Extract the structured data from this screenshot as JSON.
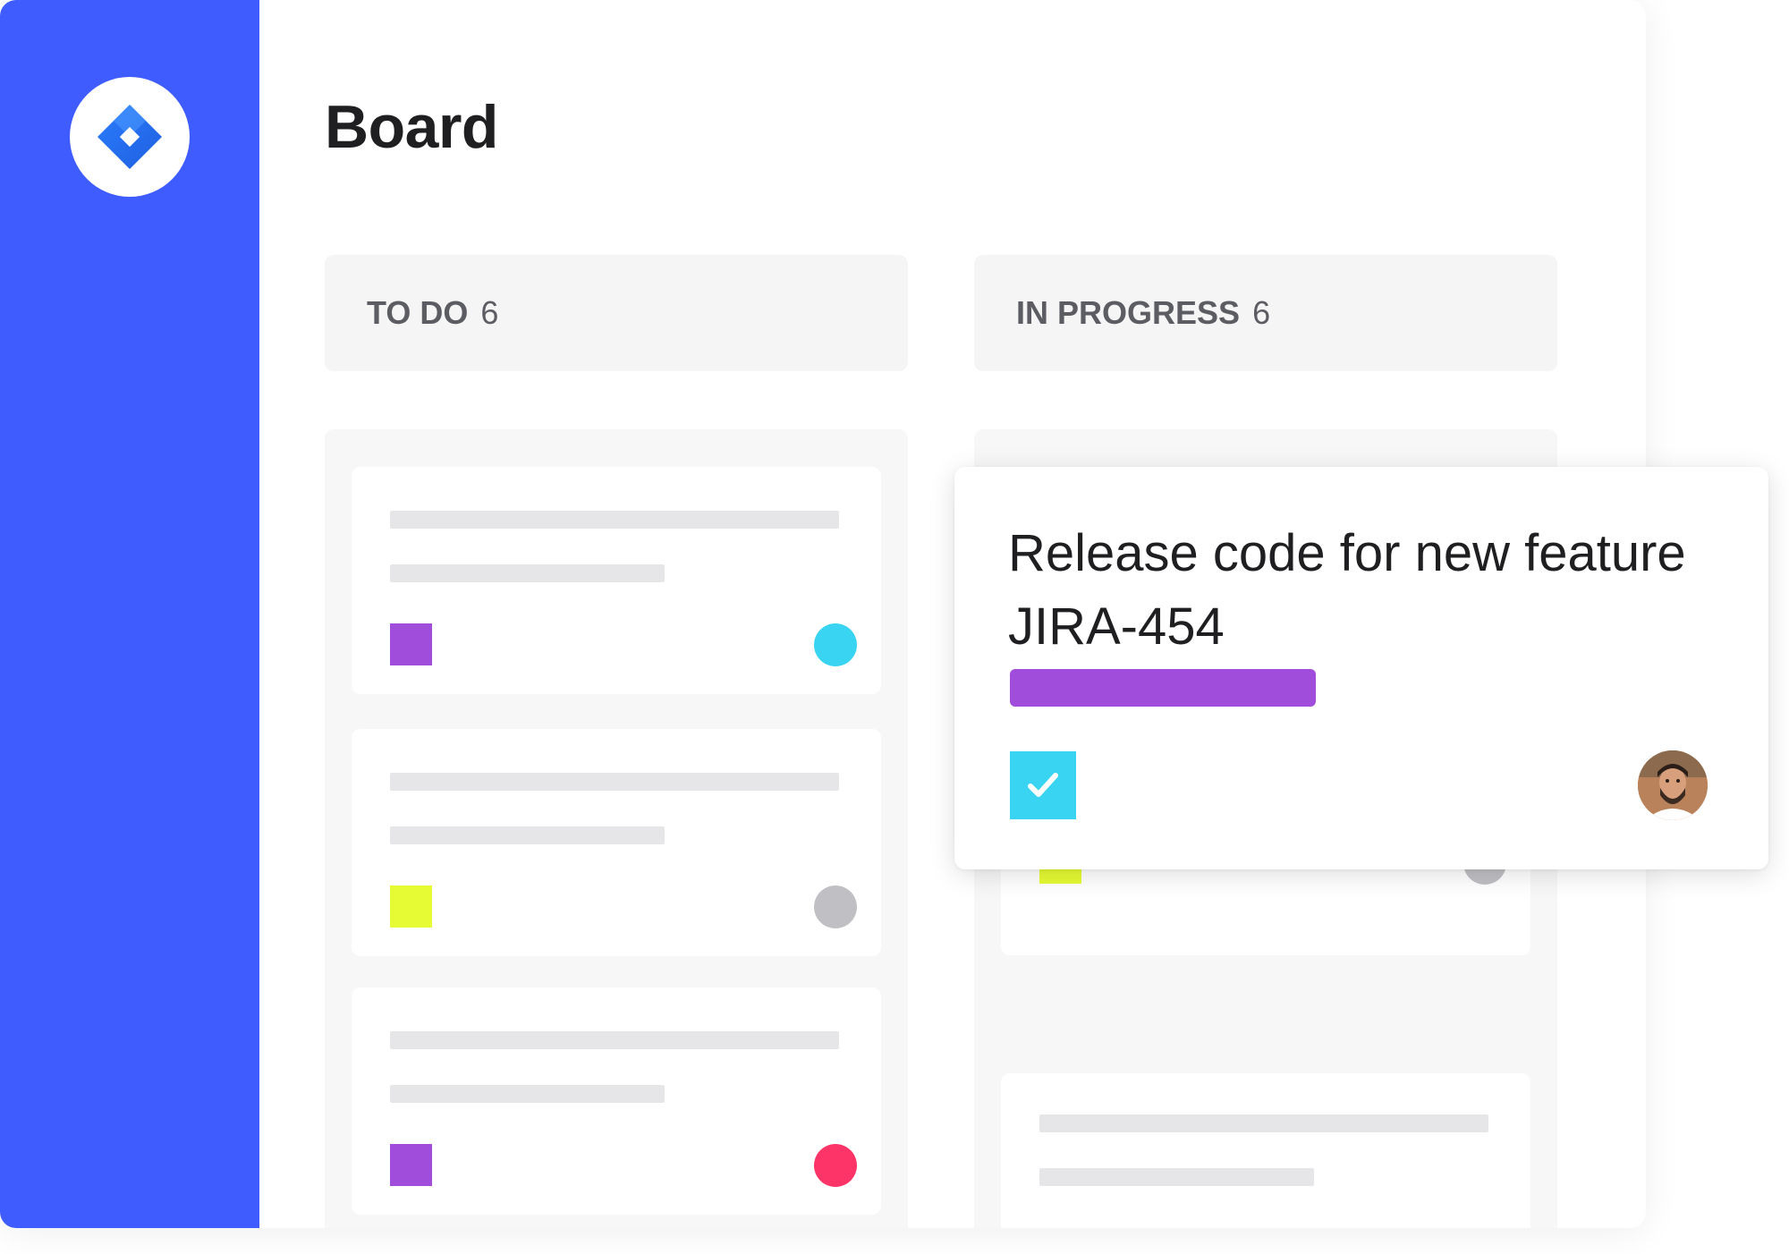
{
  "app": {
    "logo_icon": "jira-diamond-icon"
  },
  "board": {
    "title": "Board",
    "columns": [
      {
        "name": "TO DO",
        "count": "6"
      },
      {
        "name": "IN PROGRESS",
        "count": "6"
      }
    ]
  },
  "todo_cards": [
    {
      "tag_color": "#a04ddb",
      "status_color": "#38d4f2"
    },
    {
      "tag_color": "#e6fb33",
      "status_color": "#c0c0c4"
    },
    {
      "tag_color": "#a04ddb",
      "status_color": "#fd3467"
    }
  ],
  "inprogress_cards": [
    {
      "tag_color": "#e6fb33",
      "status_color": "#c0c0c4"
    },
    {
      "tag_color": null,
      "status_color": null
    }
  ],
  "floating_card": {
    "title": "Release code for new feature JIRA-454",
    "label_color": "#a04ddb",
    "checkbox_color": "#38d4f2",
    "checked": true,
    "avatar_icon": "user-avatar"
  },
  "colors": {
    "sidebar": "#3e5cff",
    "logo_blue": "#2684ff"
  }
}
